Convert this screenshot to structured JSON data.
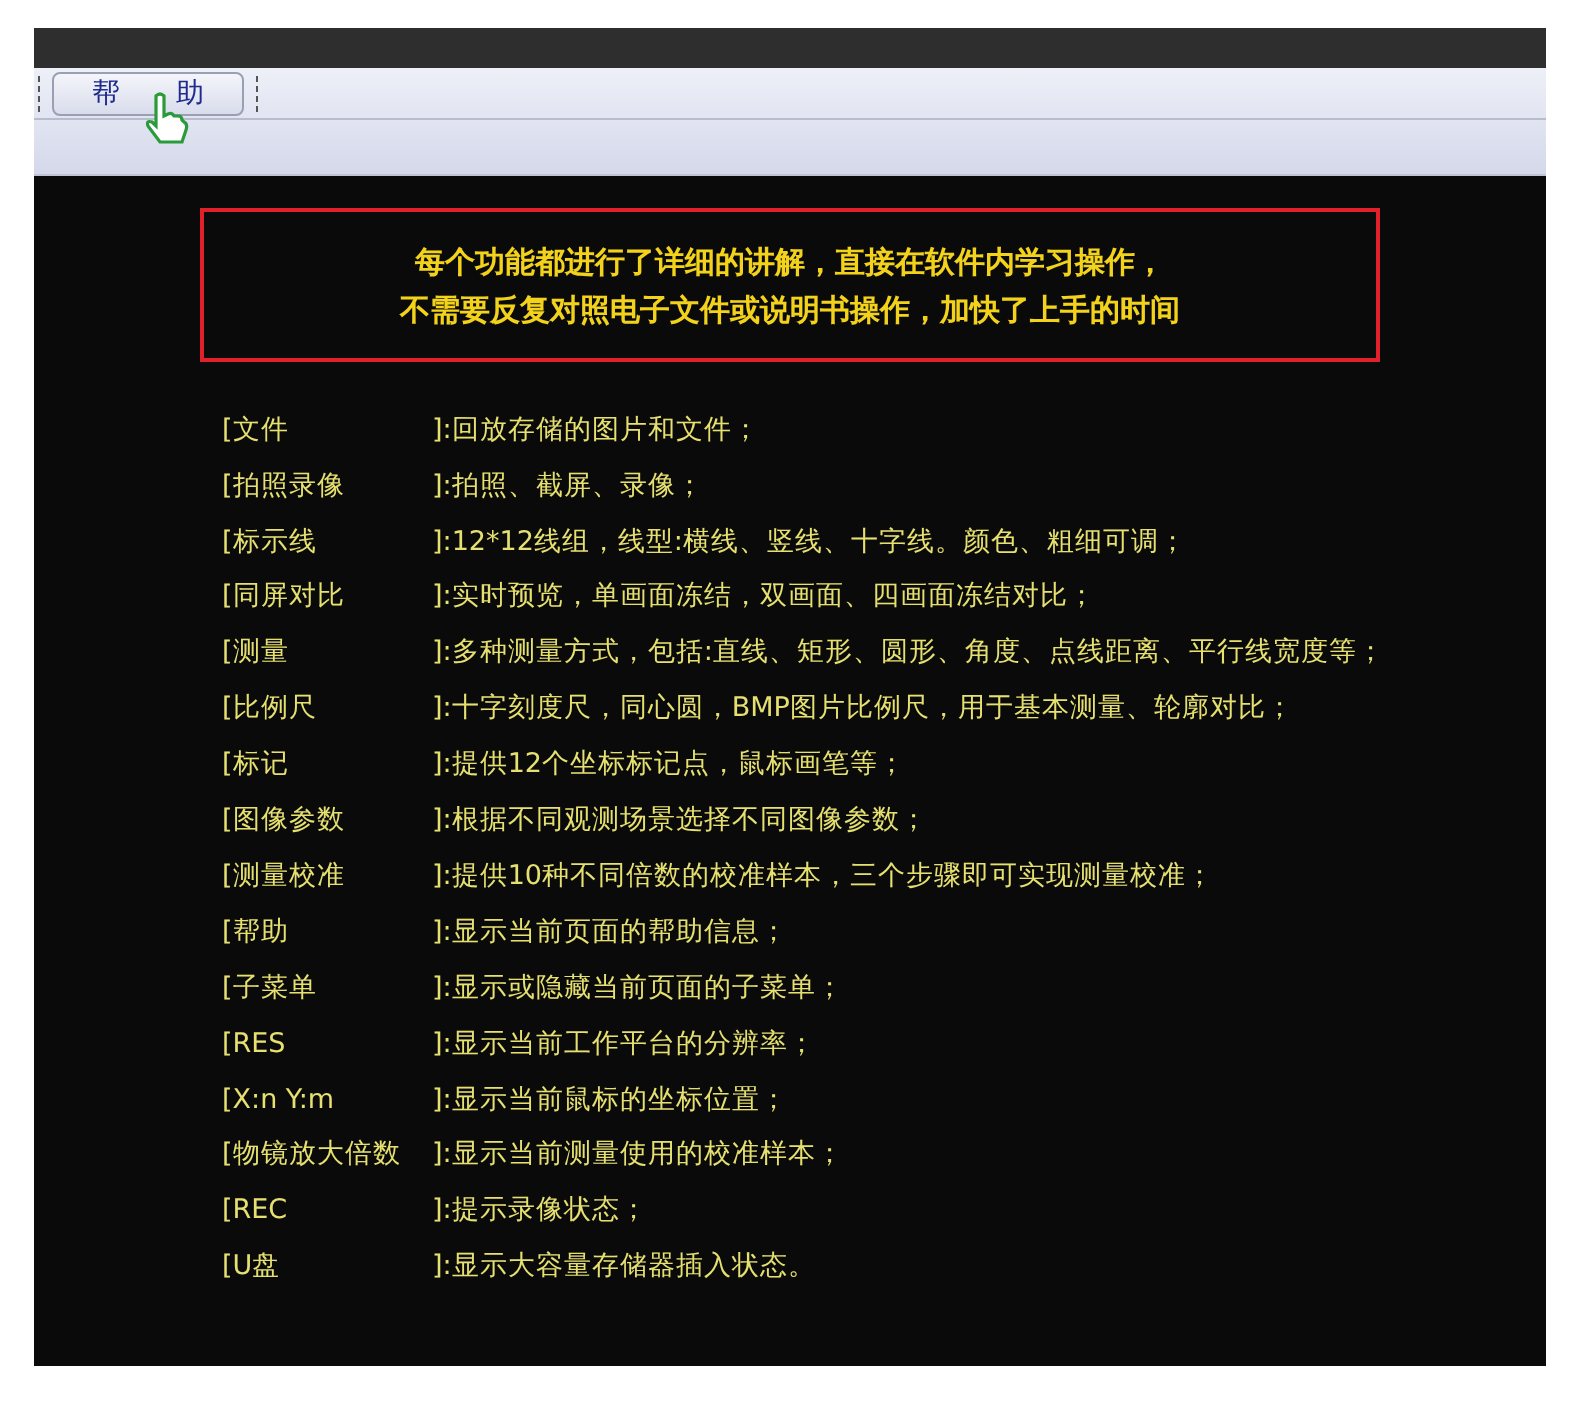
{
  "toolbar": {
    "help_button": {
      "label": "帮　　助"
    }
  },
  "banner": {
    "lines": [
      "每个功能都进行了详细的讲解，直接在软件内学习操作，",
      "不需要反复对照电子文件或说明书操作，加快了上手的时间"
    ]
  },
  "items": [
    {
      "label": "[文件",
      "description": "]:回放存储的图片和文件；"
    },
    {
      "label": "[拍照录像",
      "description": "]:拍照、截屏、录像；"
    },
    {
      "label": "[标示线",
      "description": "]:12*12线组，线型:横线、竖线、十字线。颜色、粗细可调；"
    },
    {
      "label": "[同屏对比",
      "description": "]:实时预览，单画面冻结，双画面、四画面冻结对比；"
    },
    {
      "label": "[测量",
      "description": "]:多种测量方式，包括:直线、矩形、圆形、角度、点线距离、平行线宽度等；"
    },
    {
      "label": "[比例尺",
      "description": "]:十字刻度尺，同心圆，BMP图片比例尺，用于基本测量、轮廓对比；"
    },
    {
      "label": "[标记",
      "description": "]:提供12个坐标标记点，鼠标画笔等；"
    },
    {
      "label": "[图像参数",
      "description": "]:根据不同观测场景选择不同图像参数；"
    },
    {
      "label": "[测量校准",
      "description": "]:提供10种不同倍数的校准样本，三个步骤即可实现测量校准；"
    },
    {
      "label": "[帮助",
      "description": "]:显示当前页面的帮助信息；"
    },
    {
      "label": "[子菜单",
      "description": "]:显示或隐藏当前页面的子菜单；"
    },
    {
      "label": "[RES",
      "description": "]:显示当前工作平台的分辨率；"
    },
    {
      "label": "[X:n Y:m",
      "description": "]:显示当前鼠标的坐标位置；"
    },
    {
      "label": "[物镜放大倍数",
      "description": "]:显示当前测量使用的校准样本；"
    },
    {
      "label": "[REC",
      "description": "]:提示录像状态；"
    },
    {
      "label": "[U盘",
      "description": "]:显示大容量存储器插入状态。"
    }
  ]
}
